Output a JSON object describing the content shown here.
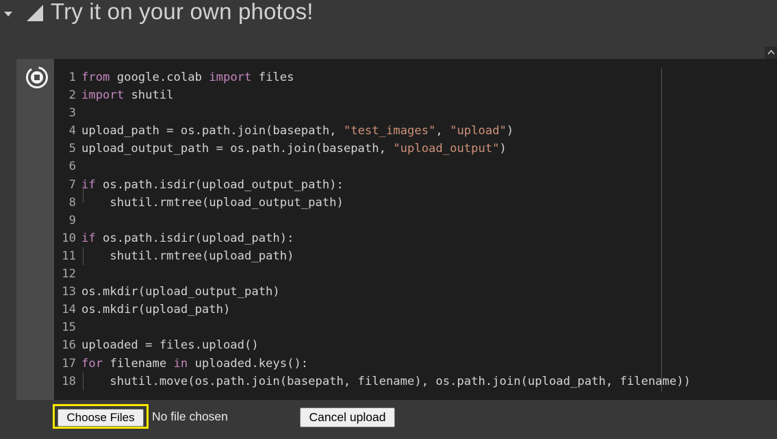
{
  "section": {
    "title": "Try it on your own photos!"
  },
  "cell": {
    "line_numbers": [
      "1",
      "2",
      "3",
      "4",
      "5",
      "6",
      "7",
      "8",
      "9",
      "10",
      "11",
      "12",
      "13",
      "14",
      "15",
      "16",
      "17",
      "18"
    ],
    "code": [
      [
        {
          "t": "from",
          "k": "kw"
        },
        {
          "t": " google.colab ",
          "k": ""
        },
        {
          "t": "import",
          "k": "kw"
        },
        {
          "t": " files",
          "k": ""
        }
      ],
      [
        {
          "t": "import",
          "k": "kw"
        },
        {
          "t": " shutil",
          "k": ""
        }
      ],
      [],
      [
        {
          "t": "upload_path = os.path.join(basepath, ",
          "k": ""
        },
        {
          "t": "\"test_images\"",
          "k": "str"
        },
        {
          "t": ", ",
          "k": ""
        },
        {
          "t": "\"upload\"",
          "k": "str"
        },
        {
          "t": ")",
          "k": ""
        }
      ],
      [
        {
          "t": "upload_output_path = os.path.join(basepath, ",
          "k": ""
        },
        {
          "t": "\"upload_output\"",
          "k": "str"
        },
        {
          "t": ")",
          "k": ""
        }
      ],
      [],
      [
        {
          "t": "if",
          "k": "kw"
        },
        {
          "t": " os.path.isdir(upload_output_path):",
          "k": ""
        }
      ],
      [
        {
          "t": "    shutil.rmtree(upload_output_path)",
          "k": ""
        }
      ],
      [],
      [
        {
          "t": "if",
          "k": "kw"
        },
        {
          "t": " os.path.isdir(upload_path):",
          "k": ""
        }
      ],
      [
        {
          "t": "    shutil.rmtree(upload_path)",
          "k": ""
        }
      ],
      [],
      [
        {
          "t": "os.mkdir(upload_output_path)",
          "k": ""
        }
      ],
      [
        {
          "t": "os.mkdir(upload_path)",
          "k": ""
        }
      ],
      [],
      [
        {
          "t": "uploaded = files.upload()",
          "k": ""
        }
      ],
      [
        {
          "t": "for",
          "k": "kw"
        },
        {
          "t": " filename ",
          "k": ""
        },
        {
          "t": "in",
          "k": "kw"
        },
        {
          "t": " uploaded.keys():",
          "k": ""
        }
      ],
      [
        {
          "t": "    shutil.move(os.path.join(basepath, filename), os.path.join(upload_path, filename))",
          "k": ""
        }
      ]
    ]
  },
  "output": {
    "choose_files_label": "Choose Files",
    "no_file_text": "No file chosen",
    "cancel_upload_label": "Cancel upload"
  },
  "icons": {
    "collapse": "caret-down-icon",
    "section": "triangle-icon",
    "run": "run-cell-icon",
    "up": "chevron-up-icon"
  },
  "colors": {
    "keyword": "#c586c0",
    "string": "#ce9178",
    "highlight": "#ffe800"
  }
}
